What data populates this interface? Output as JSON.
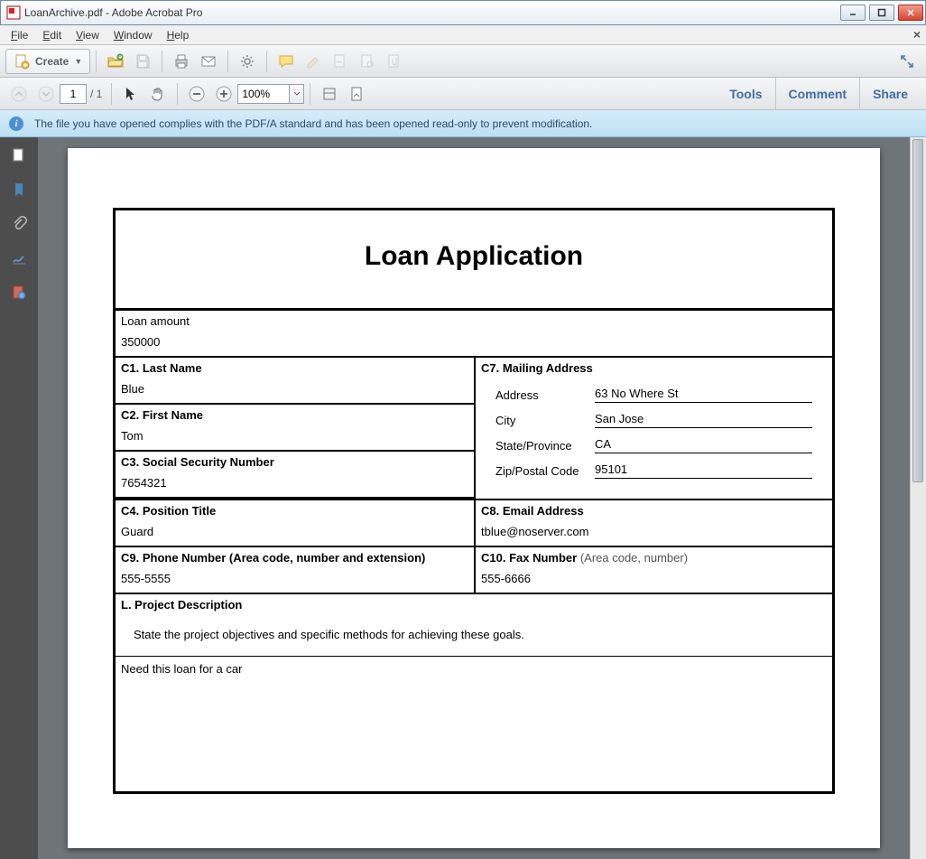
{
  "window": {
    "title": "LoanArchive.pdf - Adobe Acrobat Pro"
  },
  "menu": {
    "file": "File",
    "edit": "Edit",
    "view": "View",
    "window": "Window",
    "help": "Help"
  },
  "toolbar": {
    "create": "Create",
    "page_current": "1",
    "page_total": "/ 1",
    "zoom": "100%",
    "tools": "Tools",
    "comment": "Comment",
    "share": "Share"
  },
  "infobar": {
    "message": "The file you have opened complies with the PDF/A standard and has been opened read-only to prevent modification."
  },
  "document": {
    "title": "Loan Application",
    "loan_amount_label": "Loan amount",
    "loan_amount_value": "350000",
    "c1_label": "C1. Last Name",
    "c1_value": "Blue",
    "c2_label": "C2. First Name",
    "c2_value": "Tom",
    "c3_label": "C3. Social Security Number",
    "c3_value": "7654321",
    "c4_label": "C4. Position Title",
    "c4_value": "Guard",
    "c7_label": "C7. Mailing Address",
    "addr_label": "Address",
    "addr_value": "63 No Where St",
    "city_label": "City",
    "city_value": "San Jose",
    "state_label": "State/Province",
    "state_value": "CA",
    "zip_label": "Zip/Postal Code",
    "zip_value": "95101",
    "c8_label": "C8. Email Address",
    "c8_value": "tblue@noserver.com",
    "c9_label": "C9. Phone Number (Area code, number and extension)",
    "c9_value": "555-5555",
    "c10_label": "C10. Fax Number",
    "c10_hint": "  (Area code, number)",
    "c10_value": "555-6666",
    "proj_label": "L. Project Description",
    "proj_instr": "State the project objectives and specific methods for achieving these goals.",
    "proj_value": "Need this loan for a car"
  }
}
